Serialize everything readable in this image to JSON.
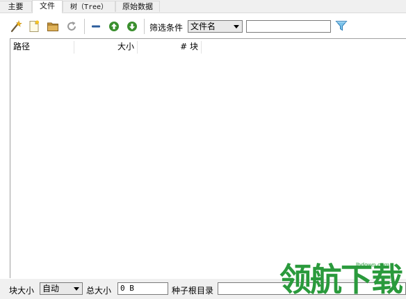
{
  "tabs": [
    {
      "label": "主要",
      "active": false
    },
    {
      "label": "文件",
      "active": true
    },
    {
      "label": "树（Tree）",
      "active": false
    },
    {
      "label": "原始数据",
      "active": false
    }
  ],
  "toolbar": {
    "icons": [
      "wand-icon",
      "new-file-icon",
      "folder-icon",
      "refresh-icon",
      "remove-icon",
      "move-up-icon",
      "move-down-icon",
      "filter-funnel-icon"
    ],
    "filter_label": "筛选条件",
    "filter_field_value": "文件名",
    "filter_text_value": ""
  },
  "file_list": {
    "columns": {
      "path": "路径",
      "size": "大小",
      "blocks": "# 块"
    },
    "rows": []
  },
  "bottom": {
    "block_size_label": "块大小",
    "block_size_value": "自动",
    "total_size_label": "总大小",
    "total_size_value": "0 B",
    "torrent_root_label": "种子根目录",
    "torrent_root_value": ""
  },
  "watermark": {
    "text": "领航下载",
    "url": "lhdown.com"
  },
  "colors": {
    "chrome_bg": "#f0f0f0",
    "accent_green": "#2a9a3c",
    "action_green": "#3a8f2e",
    "funnel_blue": "#3a9ad9"
  }
}
